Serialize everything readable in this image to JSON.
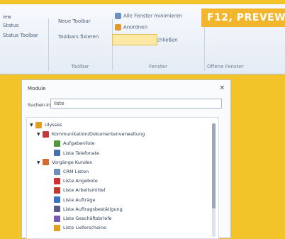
{
  "banner": "F12, PREVEW",
  "ribbon": {
    "group1": {
      "items": [
        "iew",
        "Status",
        "Status Toolbar"
      ]
    },
    "group2": {
      "items": [
        "Neue Toolbar",
        "Toolbars fixieren"
      ],
      "caption": "Toolbar"
    },
    "group3": {
      "items": [
        "Alle Fenster minimieren",
        "Anordnen",
        "Alle Fenster schließen"
      ],
      "caption": "Fenster"
    },
    "group4": {
      "caption": "Offene Fenster"
    }
  },
  "panel": {
    "title": "Module",
    "close": "×",
    "search_label": "Suchen in",
    "search_value": "liste",
    "tree": [
      {
        "toggle": "▼",
        "label": "Ulysses",
        "icon": "folder-icon",
        "color": "#e0a020"
      },
      {
        "toggle": "▼",
        "label": "Kommunikation/Dokumentenverwaltung",
        "icon": "documents-icon",
        "color": "#c23a3a"
      },
      {
        "toggle": "",
        "label": "Aufgabenliste",
        "icon": "task-icon",
        "color": "#4f9a3a"
      },
      {
        "toggle": "",
        "label": "Liste Telefonate",
        "icon": "phone-icon",
        "color": "#4a6fb0"
      },
      {
        "toggle": "▼",
        "label": "Vorgänge Kunden",
        "icon": "customer-icon",
        "color": "#d76a2a"
      },
      {
        "toggle": "",
        "label": "CRM Listen",
        "icon": "crm-icon",
        "color": "#6b8fb8"
      },
      {
        "toggle": "",
        "label": "Liste Angebote",
        "icon": "offer-icon",
        "color": "#d23030"
      },
      {
        "toggle": "",
        "label": "Liste Arbeitsmittel",
        "icon": "tools-icon",
        "color": "#c0392b"
      },
      {
        "toggle": "",
        "label": "Liste Aufträge",
        "icon": "order-icon",
        "color": "#3a72c8"
      },
      {
        "toggle": "",
        "label": "Liste Auftragsbestätigung",
        "icon": "confirm-icon",
        "color": "#5a5a8a"
      },
      {
        "toggle": "",
        "label": "Liste Geschäftsbriefe",
        "icon": "letter-icon",
        "color": "#7a5ab0"
      },
      {
        "toggle": "",
        "label": "Liste Lieferscheine",
        "icon": "delivery-icon",
        "color": "#e0a020"
      }
    ]
  }
}
